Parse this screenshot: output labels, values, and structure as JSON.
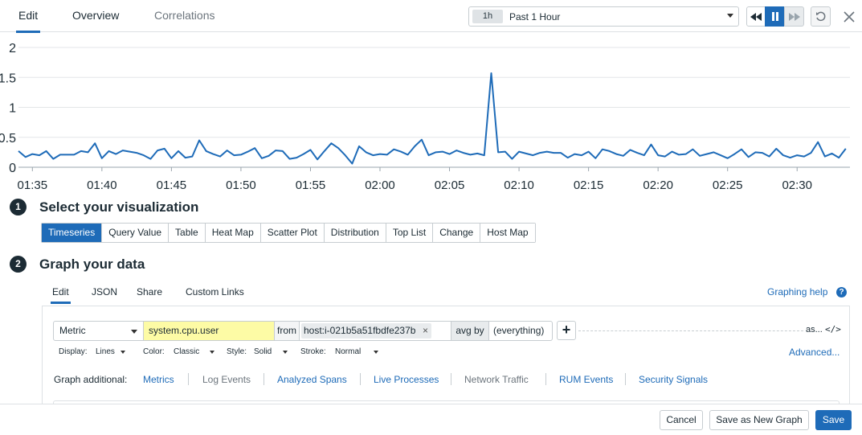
{
  "top_tabs": [
    {
      "label": "Edit",
      "active": true
    },
    {
      "label": "Overview",
      "active": false
    },
    {
      "label": "Correlations",
      "active": false
    }
  ],
  "timepicker": {
    "badge": "1h",
    "label": "Past 1 Hour"
  },
  "controls": {
    "rewind_icon": "rewind-icon",
    "pause_icon": "pause-icon",
    "forward_icon": "fast-forward-icon",
    "reset_icon": "reset-icon",
    "close_icon": "close-icon"
  },
  "chart_data": {
    "type": "line",
    "ytick_labels": [
      "0",
      "0.5",
      "1",
      "1.5",
      "2"
    ],
    "ylim": [
      0,
      2
    ],
    "xtick_labels": [
      "01:35",
      "01:40",
      "01:45",
      "01:50",
      "01:55",
      "02:00",
      "02:05",
      "02:10",
      "02:15",
      "02:20",
      "02:25",
      "02:30"
    ],
    "xlim_minutes": [
      94,
      153.8
    ],
    "grid": true,
    "color": "#1e6bb8",
    "series": [
      {
        "x_minutes": [
          94,
          94.5,
          95,
          95.5,
          96,
          96.5,
          97,
          97.5,
          98,
          98.5,
          99,
          99.5,
          100,
          100.5,
          101,
          101.5,
          102,
          102.5,
          103,
          103.5,
          104,
          104.5,
          105,
          105.5,
          106,
          106.5,
          107,
          107.5,
          108,
          108.5,
          109,
          109.5,
          110,
          110.5,
          111,
          111.5,
          112,
          112.5,
          113,
          113.5,
          114,
          114.5,
          115,
          115.5,
          116,
          116.5,
          117,
          117.5,
          118,
          118.5,
          119,
          119.5,
          120,
          120.5,
          121,
          121.5,
          122,
          122.5,
          123,
          123.5,
          124,
          124.5,
          125,
          125.5,
          126,
          126.5,
          127,
          127.5,
          128,
          128.5,
          129,
          129.5,
          130,
          130.5,
          131,
          131.5,
          132,
          132.5,
          133,
          133.5,
          134,
          134.5,
          135,
          135.5,
          136,
          136.5,
          137,
          137.5,
          138,
          138.5,
          139,
          139.5,
          140,
          140.5,
          141,
          141.5,
          142,
          142.5,
          143,
          143.5,
          144,
          144.5,
          145,
          145.5,
          146,
          146.5,
          147,
          147.5,
          148,
          148.5,
          149,
          149.5,
          150,
          150.5,
          151,
          151.5,
          152,
          152.5,
          153,
          153.5
        ],
        "y": [
          0.27,
          0.17,
          0.22,
          0.2,
          0.27,
          0.14,
          0.21,
          0.21,
          0.21,
          0.27,
          0.25,
          0.4,
          0.15,
          0.27,
          0.22,
          0.28,
          0.26,
          0.24,
          0.2,
          0.14,
          0.28,
          0.31,
          0.15,
          0.27,
          0.16,
          0.18,
          0.45,
          0.27,
          0.22,
          0.18,
          0.28,
          0.2,
          0.21,
          0.26,
          0.32,
          0.15,
          0.19,
          0.28,
          0.27,
          0.14,
          0.16,
          0.22,
          0.29,
          0.13,
          0.27,
          0.4,
          0.32,
          0.2,
          0.06,
          0.35,
          0.25,
          0.2,
          0.22,
          0.21,
          0.3,
          0.26,
          0.21,
          0.35,
          0.46,
          0.2,
          0.25,
          0.26,
          0.22,
          0.28,
          0.24,
          0.21,
          0.23,
          0.2,
          1.57,
          0.25,
          0.26,
          0.14,
          0.26,
          0.23,
          0.2,
          0.24,
          0.26,
          0.24,
          0.24,
          0.16,
          0.22,
          0.2,
          0.26,
          0.15,
          0.3,
          0.27,
          0.22,
          0.19,
          0.29,
          0.24,
          0.2,
          0.38,
          0.2,
          0.18,
          0.26,
          0.21,
          0.22,
          0.3,
          0.19,
          0.22,
          0.25,
          0.2,
          0.15,
          0.22,
          0.3,
          0.17,
          0.25,
          0.24,
          0.18,
          0.31,
          0.2,
          0.16,
          0.2,
          0.18,
          0.24,
          0.42,
          0.18,
          0.23,
          0.16,
          0.31,
          0.25,
          0.19,
          0.29,
          0.23,
          0.2
        ]
      }
    ]
  },
  "step1": {
    "num": "1",
    "title": "Select your visualization"
  },
  "visualizations": [
    "Timeseries",
    "Query Value",
    "Table",
    "Heat Map",
    "Scatter Plot",
    "Distribution",
    "Top List",
    "Change",
    "Host Map"
  ],
  "active_visualization": "Timeseries",
  "step2": {
    "num": "2",
    "title": "Graph your data"
  },
  "sub_tabs": [
    "Edit",
    "JSON",
    "Share",
    "Custom Links"
  ],
  "graphing_help": "Graphing help",
  "help_icon_glyph": "?",
  "query": {
    "type": "Metric",
    "metric": "system.cpu.user",
    "from_label": "from",
    "from_value": "host:i-021b5a51fbdfe237b",
    "remove_glyph": "×",
    "avg_by_label": "avg by",
    "avg_by_value": "(everything)",
    "plus_glyph": "+",
    "as_label": "as...",
    "code_glyph": "</>"
  },
  "display_options": {
    "display_label": "Display:",
    "display_value": "Lines",
    "color_label": "Color:",
    "color_value": "Classic",
    "style_label": "Style:",
    "style_value": "Solid",
    "stroke_label": "Stroke:",
    "stroke_value": "Normal",
    "advanced": "Advanced..."
  },
  "graph_additional": {
    "label": "Graph additional:",
    "links": [
      {
        "label": "Metrics",
        "enabled": true
      },
      {
        "label": "Log Events",
        "enabled": false
      },
      {
        "label": "Analyzed Spans",
        "enabled": true
      },
      {
        "label": "Live Processes",
        "enabled": true
      },
      {
        "label": "Network Traffic",
        "enabled": false
      },
      {
        "label": "RUM Events",
        "enabled": true
      },
      {
        "label": "Security Signals",
        "enabled": true
      }
    ]
  },
  "footer": {
    "cancel": "Cancel",
    "save_new": "Save as New Graph",
    "save": "Save"
  }
}
